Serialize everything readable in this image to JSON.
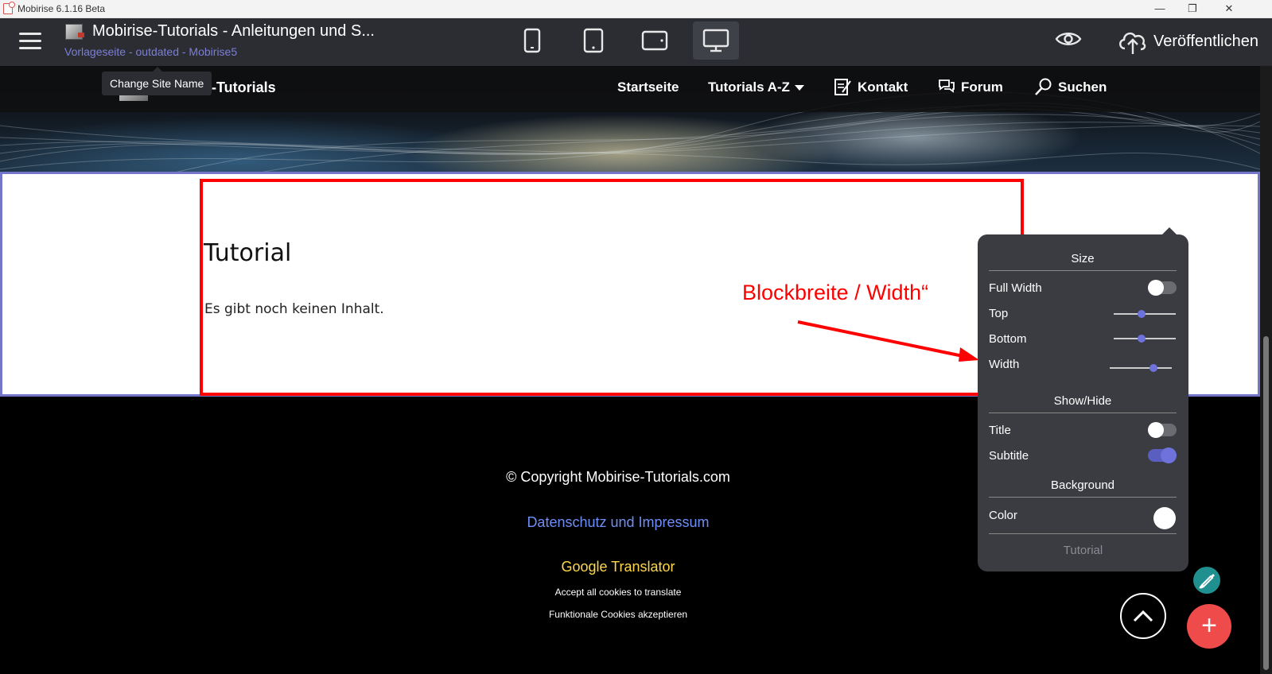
{
  "window": {
    "title": "Mobirise 6.1.16 Beta",
    "min_icon": "minimize-icon",
    "max_icon": "maximize-icon",
    "close_icon": "close-icon"
  },
  "toolbar": {
    "site_title": "Mobirise-Tutorials - Anleitungen und S...",
    "site_subtitle": "Vorlageseite - outdated - Mobirise5",
    "devices": [
      "phone",
      "tablet",
      "tablet-landscape",
      "desktop"
    ],
    "active_device": "desktop",
    "publish_label": "Veröffentlichen",
    "accent": "#7d7fd6"
  },
  "tooltip": {
    "text": "Change Site Name"
  },
  "site_nav": {
    "brand": "e-Tutorials",
    "items": [
      {
        "label": "Startseite"
      },
      {
        "label": "Tutorials A-Z"
      },
      {
        "label": "Kontakt"
      },
      {
        "label": "Forum"
      },
      {
        "label": "Suchen"
      }
    ]
  },
  "content": {
    "title": "Tutorial",
    "text": "Es gibt noch keinen Inhalt.",
    "annotation": "Blockbreite / Width“"
  },
  "footer": {
    "copyright": "© Copyright Mobirise-Tutorials.com",
    "link": "Datenschutz und Impressum",
    "translator": "Google Translator",
    "cookies_note": "Accept all cookies to translate",
    "cookies_button": "Funktionale Cookies akzeptieren"
  },
  "panel": {
    "size_heading": "Size",
    "full_width_label": "Full Width",
    "full_width": false,
    "top_label": "Top",
    "top_value": 0.45,
    "bottom_label": "Bottom",
    "bottom_value": 0.45,
    "width_label": "Width",
    "width_value": 0.7,
    "showhide_heading": "Show/Hide",
    "title_label": "Title",
    "title_on": false,
    "subtitle_label": "Subtitle",
    "subtitle_on": true,
    "background_heading": "Background",
    "color_label": "Color",
    "color_value": "#ffffff",
    "footer_label": "Tutorial"
  },
  "floating": {
    "brush_icon": "brush-icon",
    "up_icon": "chevron-up-icon",
    "add_icon": "plus-icon",
    "add_color": "#f04b4b"
  }
}
